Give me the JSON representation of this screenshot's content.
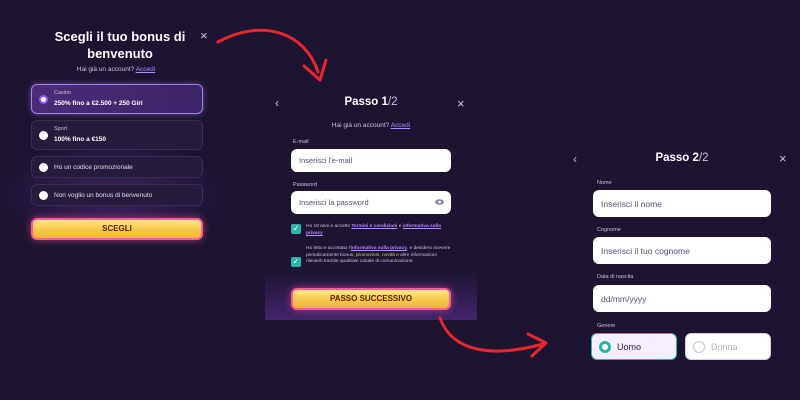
{
  "panel1": {
    "title": "Scegli il tuo bonus di benvenuto",
    "close_icon": "×",
    "login_prompt": "Hai già un account?",
    "login_link": "Accedi",
    "options": [
      {
        "small": "Casino",
        "bold": "250% fino a €2.500 + 250 Giri",
        "selected": true
      },
      {
        "small": "Sport",
        "bold": "100% fino a €150",
        "selected": false
      },
      {
        "label": "Ho un codice promozionale",
        "selected": false
      },
      {
        "label": "Non voglio un bonus di benvenuto",
        "selected": false
      }
    ],
    "button": "SCEGLI"
  },
  "panel2": {
    "step": "Passo 1",
    "step_frac": "/2",
    "back_icon": "‹",
    "close_icon": "×",
    "login_prompt": "Hai già un account?",
    "login_link": "Accedi",
    "email_label": "E-mail",
    "email_placeholder": "Inserisci l'e-mail",
    "password_label": "Password",
    "password_placeholder": "Inserisci la password",
    "consent1_pre": "Ho 18 anni e accetto",
    "consent1_link1": "Termini e condizioni",
    "consent1_mid": "e",
    "consent1_link2": "informativa sulla privacy",
    "consent2_pre": "Ho letto e accettato l'",
    "consent2_link": "informativa sulla privacy",
    "consent2_post": ", e desidero ricevere periodicamente bonus, promozioni, novità e altre informazioni rilevanti tramite qualsiasi canale di comunicazione.",
    "button": "PASSO SUCCESSIVO"
  },
  "panel3": {
    "step": "Passo 2",
    "step_frac": "/2",
    "back_icon": "‹",
    "close_icon": "×",
    "name_label": "Nome",
    "name_placeholder": "Inserisci il nome",
    "surname_label": "Cognome",
    "surname_placeholder": "Inserisci il tuo cognome",
    "dob_label": "Data di nascita",
    "dob_placeholder": "dd/mm/yyyy",
    "gender_label": "Genere",
    "gender_male": "Uomo",
    "gender_female": "Donna"
  },
  "colors": {
    "background": "#1d1431",
    "accent_purple": "#b78bff",
    "accent_teal": "#2bb5a8",
    "arrow_red": "#e8262d",
    "button_yellow": "#f7c84a"
  }
}
